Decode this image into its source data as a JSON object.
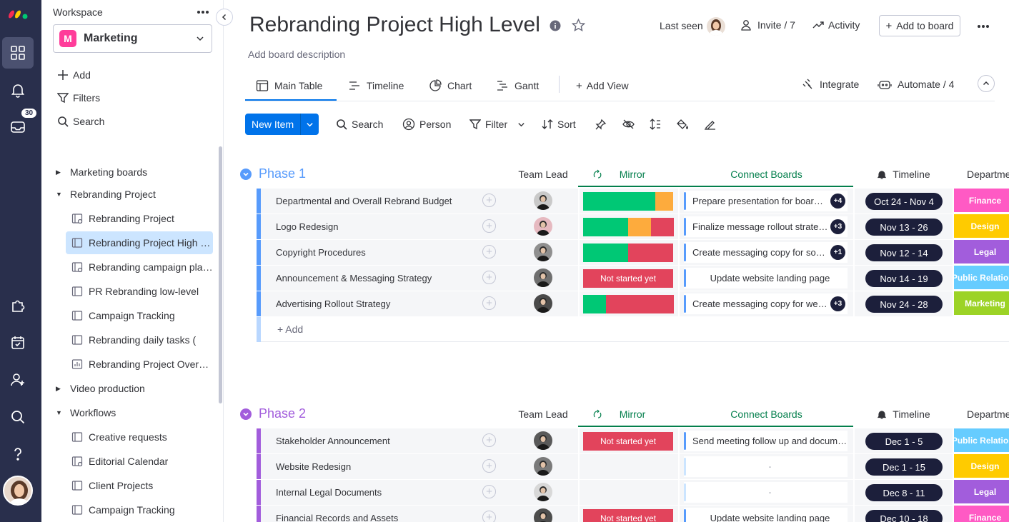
{
  "sidebar_rail": {
    "inbox_badge": "30",
    "icons": [
      "monday-logo-icon",
      "workspace-grid-icon",
      "bell-icon",
      "inbox-icon",
      "puzzle-icon",
      "calendar-check-icon",
      "add-person-icon",
      "search-icon",
      "help-icon",
      "user-avatar"
    ]
  },
  "workspace": {
    "label": "Workspace",
    "name": "Marketing",
    "name_initial": "M",
    "actions": {
      "add": "Add",
      "filters": "Filters",
      "search": "Search"
    },
    "tree": [
      {
        "type": "folder",
        "label": "Marketing boards",
        "expanded": false
      },
      {
        "type": "folder",
        "label": "Rebranding Project",
        "expanded": true
      },
      {
        "type": "board",
        "label": "Rebranding Project",
        "icon": "board-share-icon"
      },
      {
        "type": "board",
        "label": "Rebranding Project High Level",
        "icon": "board-icon",
        "selected": true
      },
      {
        "type": "board",
        "label": "Rebranding campaign planning",
        "icon": "board-share-icon"
      },
      {
        "type": "board",
        "label": "PR Rebranding low-level",
        "icon": "board-icon"
      },
      {
        "type": "board",
        "label": "Campaign Tracking",
        "icon": "board-icon"
      },
      {
        "type": "board",
        "label": "Rebranding daily tasks (",
        "icon": "board-icon"
      },
      {
        "type": "board",
        "label": "Rebranding Project Overview",
        "icon": "dashboard-icon"
      },
      {
        "type": "folder",
        "label": "Video production",
        "expanded": false
      },
      {
        "type": "folder",
        "label": "Workflows",
        "expanded": true
      },
      {
        "type": "board",
        "label": "Creative requests",
        "icon": "board-icon"
      },
      {
        "type": "board",
        "label": "Editorial Calendar",
        "icon": "board-share-icon"
      },
      {
        "type": "board",
        "label": "Client Projects",
        "icon": "board-icon"
      },
      {
        "type": "board",
        "label": "Campaign Tracking",
        "icon": "board-icon"
      }
    ]
  },
  "board": {
    "title": "Rebranding Project High Level",
    "description": "Add board description",
    "last_seen": "Last seen",
    "invite": "Invite / 7",
    "activity": "Activity",
    "add_to_board": "Add to board",
    "tabs": [
      "Main Table",
      "Timeline",
      "Chart",
      "Gantt"
    ],
    "add_view": "Add View",
    "integrate": "Integrate",
    "automate": "Automate / 4",
    "toolbar": {
      "new_item": "New Item",
      "search": "Search",
      "person": "Person",
      "filter": "Filter",
      "sort": "Sort"
    },
    "columns": {
      "team_lead": "Team Lead",
      "mirror": "Mirror",
      "connect": "Connect Boards",
      "timeline": "Timeline",
      "department": "Departme"
    },
    "add_item": "+ Add",
    "not_started": "Not started yet",
    "empty": "-",
    "colors": {
      "green": "#00c875",
      "orange": "#fdab3d",
      "red": "#e2445c",
      "phase1": "#579bfc",
      "phase2": "#a25ddc",
      "primary": "#0073ea"
    },
    "groups": [
      {
        "name": "Phase 1",
        "rows": [
          {
            "name": "Departmental and Overall Rebrand Budget",
            "mirror": [
              [
                "green",
                0.8
              ],
              [
                "orange",
                0.2
              ]
            ],
            "connect": "Prepare presentation for board members",
            "more": "+4",
            "timeline": "Oct 24 - Nov 4",
            "dept": "Finance",
            "dept_color": "#ff5ac4"
          },
          {
            "name": "Logo Redesign",
            "mirror": [
              [
                "green",
                0.5
              ],
              [
                "orange",
                0.25
              ],
              [
                "red",
                0.25
              ]
            ],
            "connect": "Finalize message rollout strategy",
            "more": "+3",
            "timeline": "Nov 13 - 26",
            "dept": "Design",
            "dept_color": "#ffcb00"
          },
          {
            "name": "Copyright Procedures",
            "mirror": [
              [
                "green",
                0.5
              ],
              [
                "red",
                0.5
              ]
            ],
            "connect": "Create messaging copy for social",
            "more": "+1",
            "timeline": "Nov 12 - 14",
            "dept": "Legal",
            "dept_color": "#a25ddc"
          },
          {
            "name": "Announcement & Messaging Strategy",
            "mirror": "not_started",
            "connect": "Update website landing page",
            "more": "",
            "timeline": "Nov 14 - 19",
            "dept": "Public Relations",
            "dept_color": "#66ccff"
          },
          {
            "name": "Advertising Rollout Strategy",
            "mirror": [
              [
                "green",
                0.25
              ],
              [
                "red",
                0.75
              ]
            ],
            "connect": "Create messaging copy for website",
            "more": "+3",
            "timeline": "Nov 24 - 28",
            "dept": "Marketing",
            "dept_color": "#9cd326"
          }
        ]
      },
      {
        "name": "Phase 2",
        "rows": [
          {
            "name": "Stakeholder Announcement",
            "mirror": "not_started",
            "connect": "Send meeting follow up and documents",
            "more": "",
            "timeline": "Dec 1 - 5",
            "dept": "Public Relations",
            "dept_color": "#66ccff"
          },
          {
            "name": "Website Redesign",
            "mirror": "empty",
            "connect": "-",
            "more": "",
            "timeline": "Dec 1 - 15",
            "dept": "Design",
            "dept_color": "#ffcb00"
          },
          {
            "name": "Internal Legal Documents",
            "mirror": "empty",
            "connect": "-",
            "more": "",
            "timeline": "Dec 8 - 11",
            "dept": "Legal",
            "dept_color": "#a25ddc"
          },
          {
            "name": "Financial Records and Assets",
            "mirror": "not_started",
            "connect": "Update website landing page",
            "more": "",
            "timeline": "Dec 10 - 18",
            "dept": "Finance",
            "dept_color": "#ff5ac4"
          }
        ]
      }
    ]
  }
}
